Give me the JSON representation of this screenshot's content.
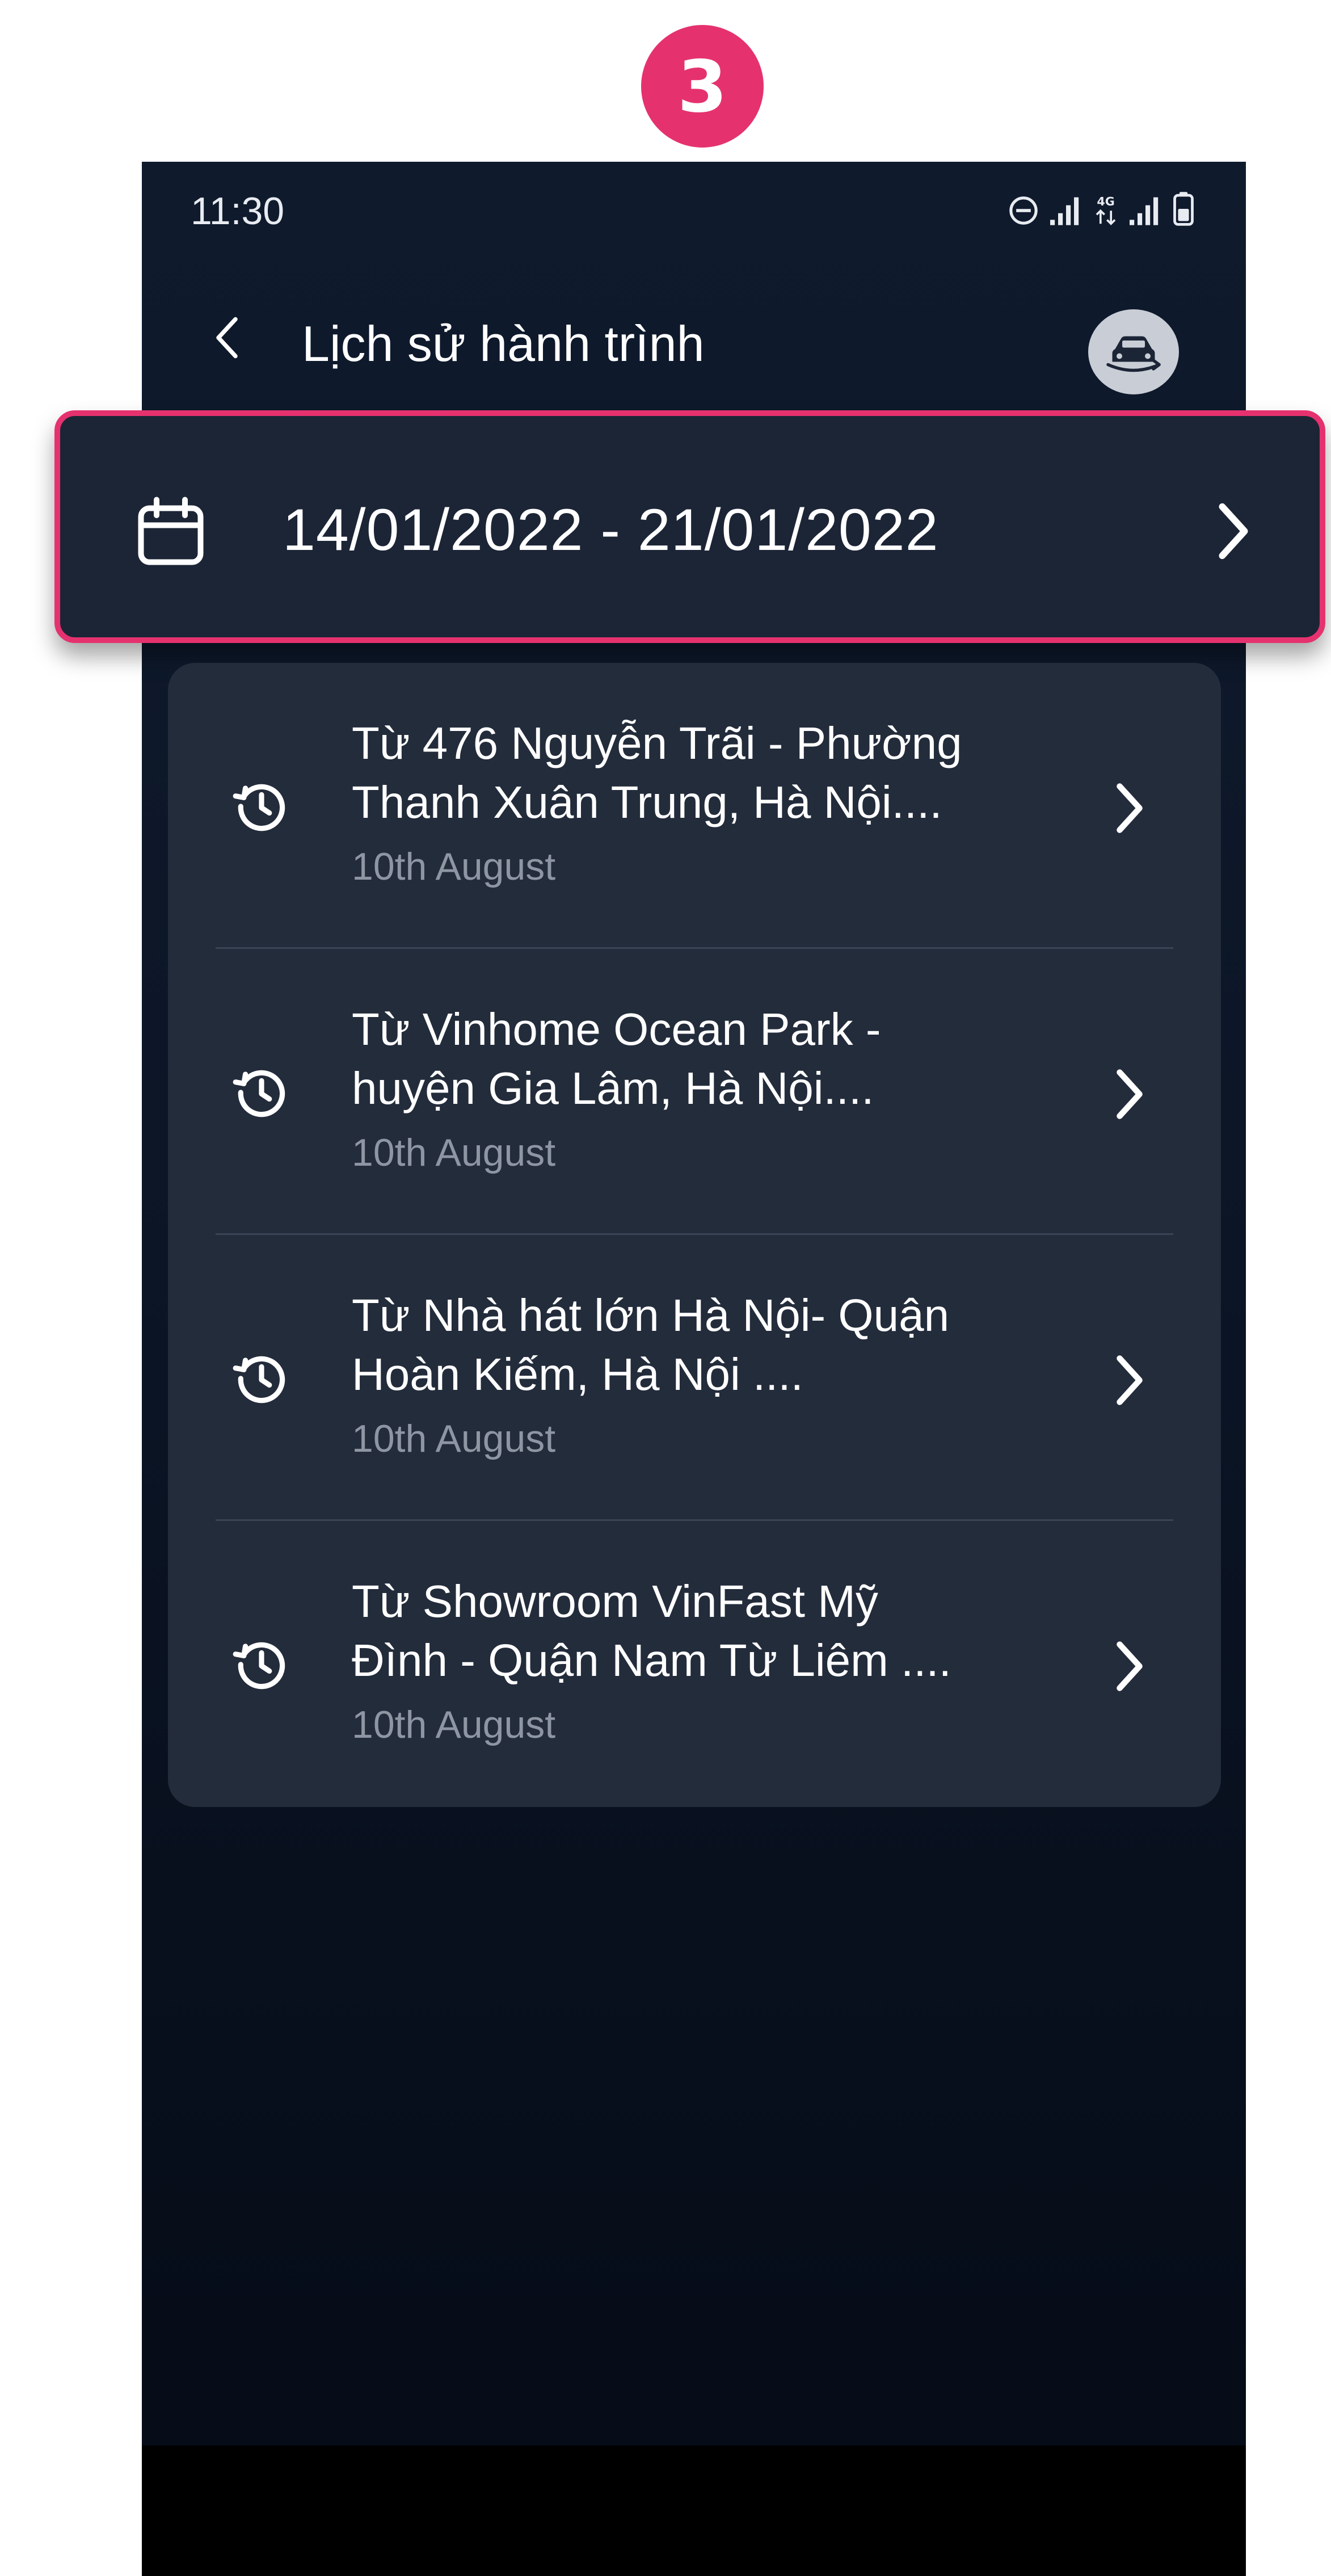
{
  "step_badge": "3",
  "status_bar": {
    "time": "11:30",
    "icons": [
      "do-not-disturb-icon",
      "signal-icon",
      "4g-icon",
      "signal-icon",
      "battery-icon"
    ]
  },
  "header": {
    "title": "Lịch sử hành trình",
    "back_icon": "chevron-left-icon",
    "car_icon": "car-rotate-icon"
  },
  "date_filter": {
    "range": "14/01/2022 - 21/01/2022",
    "icon": "calendar-icon"
  },
  "trips": [
    {
      "title_line1": "Từ 476 Nguyễn Trãi - Phường",
      "title_line2": "Thanh Xuân Trung, Hà Nội....",
      "date": "10th August"
    },
    {
      "title_line1": "Từ Vinhome Ocean Park -",
      "title_line2": "huyện Gia Lâm, Hà Nội....",
      "date": "10th August"
    },
    {
      "title_line1": "Từ Nhà hát lớn Hà Nội- Quận",
      "title_line2": "Hoàn Kiếm, Hà Nội ....",
      "date": "10th August"
    },
    {
      "title_line1": "Từ Showroom VinFast Mỹ",
      "title_line2": "Đình - Quận Nam Từ Liêm ....",
      "date": "10th August"
    }
  ],
  "colors": {
    "accent": "#e5326f",
    "background": "#0c1627",
    "card": "#232c3b",
    "text_primary": "#ffffff",
    "text_secondary": "#8e96a3"
  }
}
